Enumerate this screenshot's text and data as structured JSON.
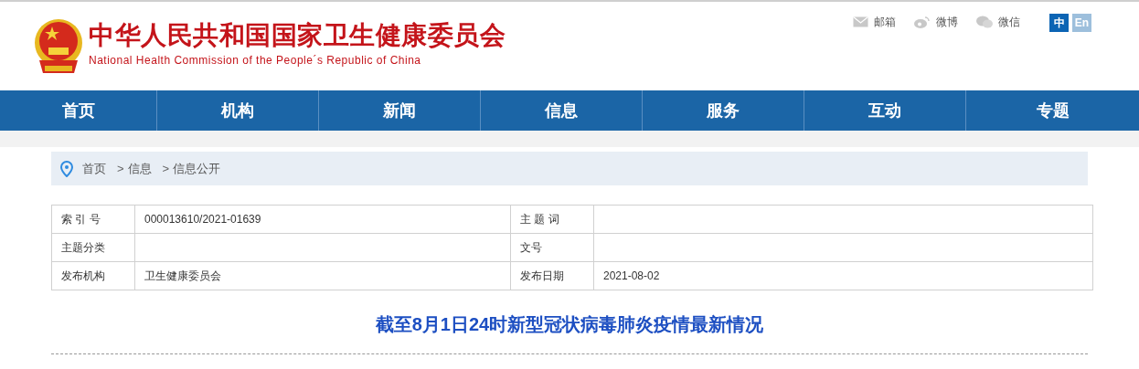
{
  "header": {
    "title": "中华人民共和国国家卫生健康委员会",
    "subtitle": "National Health Commission of the People´s Republic of China",
    "links": [
      {
        "kind": "mail",
        "label": "邮箱"
      },
      {
        "kind": "weibo",
        "label": "微博"
      },
      {
        "kind": "wechat",
        "label": "微信"
      }
    ],
    "languages": [
      {
        "label": "中",
        "selected": true
      },
      {
        "label": "En",
        "selected": false
      }
    ]
  },
  "nav": [
    {
      "label": "首页"
    },
    {
      "label": "机构"
    },
    {
      "label": "新闻"
    },
    {
      "label": "信息"
    },
    {
      "label": "服务"
    },
    {
      "label": "互动"
    },
    {
      "label": "专题"
    }
  ],
  "breadcrumb": [
    "首页",
    "信息",
    "信息公开"
  ],
  "breadcrumb_separator": ">",
  "info_table": [
    [
      {
        "label": "索 引 号",
        "value": "000013610/2021-01639"
      },
      {
        "label": "主 题 词"
      }
    ],
    [
      {
        "label": "主题分类"
      },
      {
        "label": "文号"
      }
    ],
    [
      {
        "label": "发布机构",
        "value": "卫生健康委员会"
      },
      {
        "label": "发布日期",
        "value": "2021-08-02"
      }
    ]
  ],
  "article": {
    "title": "截至8月1日24时新型冠状病毒肺炎疫情最新情况"
  }
}
